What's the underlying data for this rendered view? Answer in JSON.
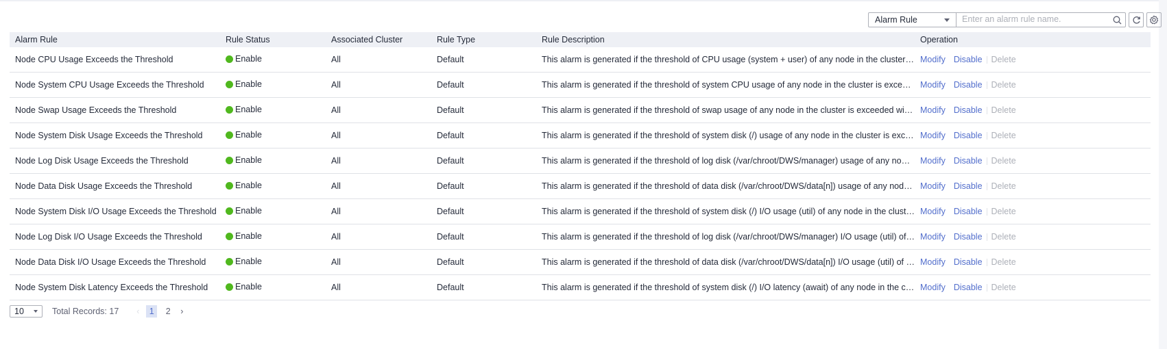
{
  "search": {
    "filter_label": "Alarm Rule",
    "placeholder": "Enter an alarm rule name."
  },
  "columns": [
    "Alarm Rule",
    "Rule Status",
    "Associated Cluster",
    "Rule Type",
    "Rule Description",
    "Operation"
  ],
  "rows": [
    {
      "rule": "Node CPU Usage Exceeds the Threshold",
      "status": "Enable",
      "cluster": "All",
      "type": "Default",
      "desc": "This alarm is generated if the threshold of CPU usage (system + user) of any node in the cluster is exceeded within the specified period."
    },
    {
      "rule": "Node System CPU Usage Exceeds the Threshold",
      "status": "Enable",
      "cluster": "All",
      "type": "Default",
      "desc": "This alarm is generated if the threshold of system CPU usage of any node in the cluster is exceeded within the specified period."
    },
    {
      "rule": "Node Swap Usage Exceeds the Threshold",
      "status": "Enable",
      "cluster": "All",
      "type": "Default",
      "desc": "This alarm is generated if the threshold of swap usage of any node in the cluster is exceeded within the specified period."
    },
    {
      "rule": "Node System Disk Usage Exceeds the Threshold",
      "status": "Enable",
      "cluster": "All",
      "type": "Default",
      "desc": "This alarm is generated if the threshold of system disk (/) usage of any node in the cluster is exceeded within the specified period."
    },
    {
      "rule": "Node Log Disk Usage Exceeds the Threshold",
      "status": "Enable",
      "cluster": "All",
      "type": "Default",
      "desc": "This alarm is generated if the threshold of log disk (/var/chroot/DWS/manager) usage of any node in the cluster is exceeded."
    },
    {
      "rule": "Node Data Disk Usage Exceeds the Threshold",
      "status": "Enable",
      "cluster": "All",
      "type": "Default",
      "desc": "This alarm is generated if the threshold of data disk (/var/chroot/DWS/data[n]) usage of any node in the cluster is exceeded."
    },
    {
      "rule": "Node System Disk I/O Usage Exceeds the Threshold",
      "status": "Enable",
      "cluster": "All",
      "type": "Default",
      "desc": "This alarm is generated if the threshold of system disk (/) I/O usage (util) of any node in the cluster is exceeded."
    },
    {
      "rule": "Node Log Disk I/O Usage Exceeds the Threshold",
      "status": "Enable",
      "cluster": "All",
      "type": "Default",
      "desc": "This alarm is generated if the threshold of log disk (/var/chroot/DWS/manager) I/O usage (util) of any node in the cluster is exceeded."
    },
    {
      "rule": "Node Data Disk I/O Usage Exceeds the Threshold",
      "status": "Enable",
      "cluster": "All",
      "type": "Default",
      "desc": "This alarm is generated if the threshold of data disk (/var/chroot/DWS/data[n]) I/O usage (util) of any node in the cluster is exceeded."
    },
    {
      "rule": "Node System Disk Latency Exceeds the Threshold",
      "status": "Enable",
      "cluster": "All",
      "type": "Default",
      "desc": "This alarm is generated if the threshold of system disk (/) I/O latency (await) of any node in the cluster is exceeded."
    }
  ],
  "operations": {
    "modify": "Modify",
    "disable": "Disable",
    "delete": "Delete"
  },
  "pagination": {
    "page_size": "10",
    "total": "Total Records: 17",
    "pages": [
      "1",
      "2"
    ],
    "current": "1"
  },
  "colors": {
    "accent": "#526ecc",
    "enabled_dot": "#50b81e",
    "header_bg": "#eef0f5"
  }
}
